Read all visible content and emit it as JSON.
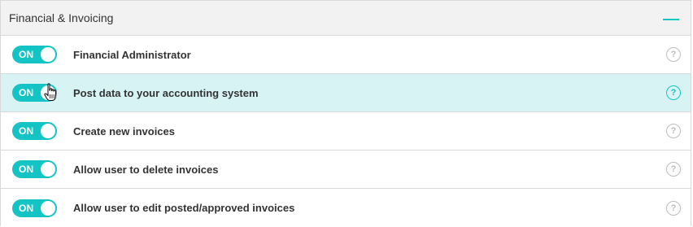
{
  "section": {
    "title": "Financial & Invoicing"
  },
  "permissions": [
    {
      "toggle": "ON",
      "label": "Financial Administrator",
      "help": "?"
    },
    {
      "toggle": "ON",
      "label": "Post data to your accounting system",
      "help": "?"
    },
    {
      "toggle": "ON",
      "label": "Create new invoices",
      "help": "?"
    },
    {
      "toggle": "ON",
      "label": "Allow user to delete invoices",
      "help": "?"
    },
    {
      "toggle": "ON",
      "label": "Allow user to edit posted/approved invoices",
      "help": "?"
    }
  ],
  "colors": {
    "accent": "#14c3c3",
    "highlight_row": "#d8f3f4",
    "header_bg": "#f2f2f2"
  },
  "icons": {
    "collapse": "minus-icon",
    "help": "question-circle-icon",
    "cursor": "hand-pointer-icon"
  }
}
